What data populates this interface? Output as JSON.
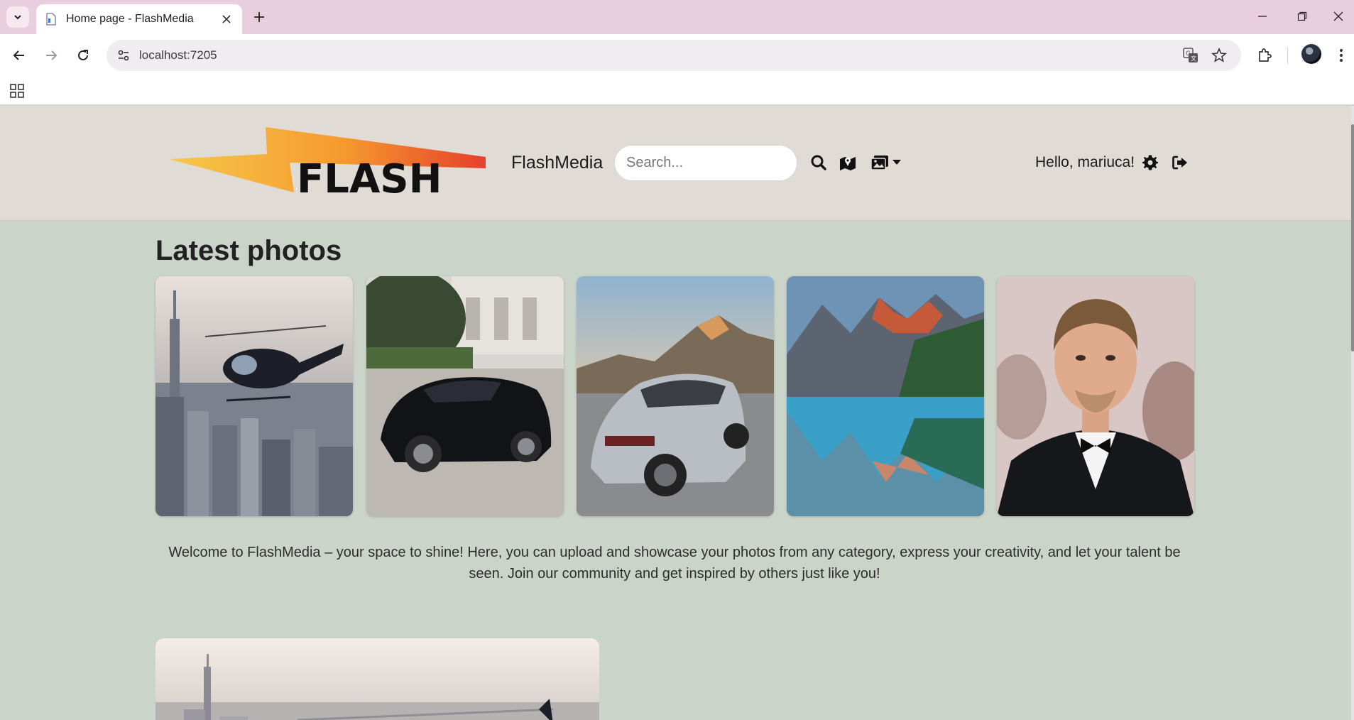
{
  "browser": {
    "tab_title": "Home page - FlashMedia",
    "url": "localhost:7205",
    "icons": [
      "tab-search-icon",
      "page-favicon-icon",
      "close-tab-icon",
      "new-tab-icon",
      "minimize-icon",
      "restore-icon",
      "close-window-icon",
      "back-icon",
      "forward-icon",
      "reload-icon",
      "site-info-icon",
      "translate-icon",
      "bookmark-star-icon",
      "extensions-icon",
      "profile-avatar",
      "more-menu-icon",
      "apps-grid-icon"
    ]
  },
  "header": {
    "logo_text": "FLASH",
    "brand": "FlashMedia",
    "search_placeholder": "Search...",
    "greeting": "Hello, mariuca!",
    "icons": [
      "search-icon",
      "map-icon",
      "images-icon",
      "caret-down-icon",
      "gear-icon",
      "logout-icon"
    ]
  },
  "main": {
    "section_title": "Latest photos",
    "photos": [
      {
        "subject": "helicopter over city"
      },
      {
        "subject": "black sports car"
      },
      {
        "subject": "silver SUV by mountains"
      },
      {
        "subject": "mountain lake"
      },
      {
        "subject": "man in tuxedo"
      }
    ],
    "welcome_text": "Welcome to FlashMedia – your space to shine! Here, you can upload and showcase your photos from any category, express your creativity, and let your talent be seen. Join our community and get inspired by others just like you!"
  },
  "colors": {
    "tabbar": "#e8cede",
    "header": "#e1dbd5",
    "page_background": "#cbd4c8"
  }
}
